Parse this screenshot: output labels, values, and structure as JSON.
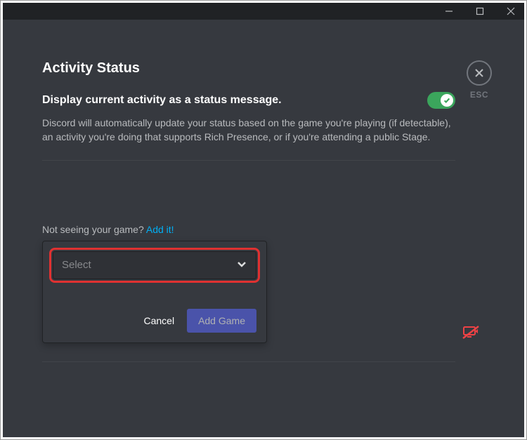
{
  "window": {
    "esc_label": "ESC"
  },
  "page": {
    "title": "Activity Status",
    "setting_label": "Display current activity as a status message.",
    "setting_description": "Discord will automatically update your status based on the game you're playing (if detectable), an activity you're doing that supports Rich Presence, or if you're attending a public Stage.",
    "toggle_on": true
  },
  "add_game": {
    "prompt_text": "Not seeing your game? ",
    "prompt_link": "Add it!",
    "select_placeholder": "Select",
    "cancel_label": "Cancel",
    "add_label": "Add Game"
  },
  "colors": {
    "accent_green": "#3ba55c",
    "accent_blurple": "#5865f2",
    "danger_red": "#ed4245",
    "highlight_box": "#e03131"
  }
}
